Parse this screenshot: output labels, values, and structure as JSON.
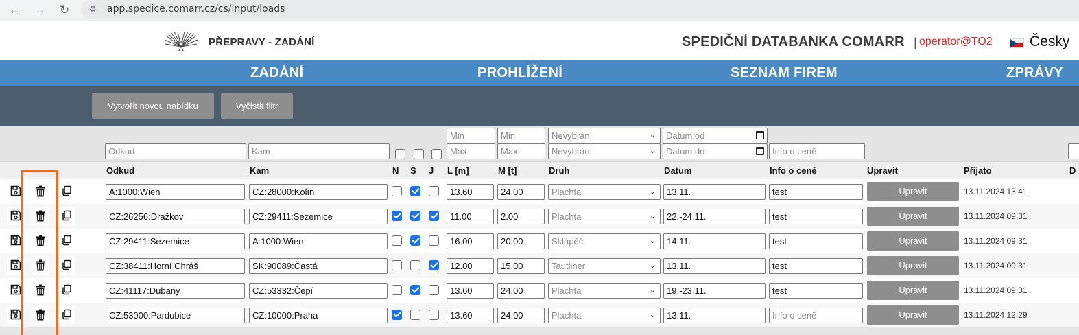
{
  "browser": {
    "url": "app.spedice.comarr.cz/cs/input/loads"
  },
  "header": {
    "title": "PŘEPRAVY - ZADÁNÍ",
    "site_name": "SPEDIČNÍ DATABANKA COMARR",
    "separator": "|",
    "user": "operator@TO2",
    "language": "Česky"
  },
  "menu": {
    "items": [
      "ZADÁNÍ",
      "PROHLÍŽENÍ",
      "SEZNAM FIREM",
      "ZPRÁVY"
    ]
  },
  "actions": {
    "new_offer": "Vytvořit novou nabídku",
    "clear_filter": "Vyčistit filtr"
  },
  "filters": {
    "from_ph": "Odkud",
    "to_ph": "Kam",
    "length_min_ph": "Min",
    "length_max_ph": "Max",
    "weight_min_ph": "Min",
    "weight_max_ph": "Max",
    "type_1": "Nevybrán",
    "type_2": "Nevybrán",
    "date_from_ph": "Datum od",
    "date_to_ph": "Datum do",
    "price_ph": "Info o ceně"
  },
  "columns": {
    "from": "Odkud",
    "to": "Kam",
    "n": "N",
    "s": "S",
    "j": "J",
    "length": "L [m]",
    "weight": "M [t]",
    "type": "Druh",
    "date": "Datum",
    "price": "Info o ceně",
    "edit": "Upravit",
    "received": "Přijato",
    "extra": "D"
  },
  "edit_label": "Upravit",
  "price_placeholder": "Info o ceně",
  "rows": [
    {
      "from": "A:1000:Wien",
      "to": "CZ:28000:Kolín",
      "n": false,
      "s": true,
      "j": false,
      "length": "13.60",
      "weight": "24.00",
      "type": "Plachta",
      "date": "13.11.",
      "price": "test",
      "received": "13.11.2024 13:41"
    },
    {
      "from": "CZ:26256:Dražkov",
      "to": "CZ:29411:Sezemice",
      "n": true,
      "s": true,
      "j": true,
      "length": "11.00",
      "weight": "2.00",
      "type": "Plachta",
      "date": "22.-24.11.",
      "price": "test",
      "received": "13.11.2024 09:31"
    },
    {
      "from": "CZ:29411:Sezemice",
      "to": "A:1000:Wien",
      "n": false,
      "s": true,
      "j": false,
      "length": "16.00",
      "weight": "20.00",
      "type": "Sklápěč",
      "date": "14.11.",
      "price": "test",
      "received": "13.11.2024 09:31"
    },
    {
      "from": "CZ:38411:Horní Chráš",
      "to": "SK:90089:Častá",
      "n": false,
      "s": false,
      "j": true,
      "length": "12.00",
      "weight": "15.00",
      "type": "Tautliner",
      "date": "13.11.",
      "price": "test",
      "received": "13.11.2024 09:31"
    },
    {
      "from": "CZ:41117:Dubany",
      "to": "CZ:53332:Čepí",
      "n": false,
      "s": true,
      "j": false,
      "length": "13.60",
      "weight": "24.00",
      "type": "Plachta",
      "date": "19.-23.11.",
      "price": "test",
      "received": "13.11.2024 09:31"
    },
    {
      "from": "CZ:53000:Pardubice",
      "to": "CZ:10000:Praha",
      "n": true,
      "s": false,
      "j": false,
      "length": "13.60",
      "weight": "24.00",
      "type": "Plachta",
      "date": "13.11.",
      "price": "",
      "received": "13.11.2024 12:29"
    }
  ]
}
